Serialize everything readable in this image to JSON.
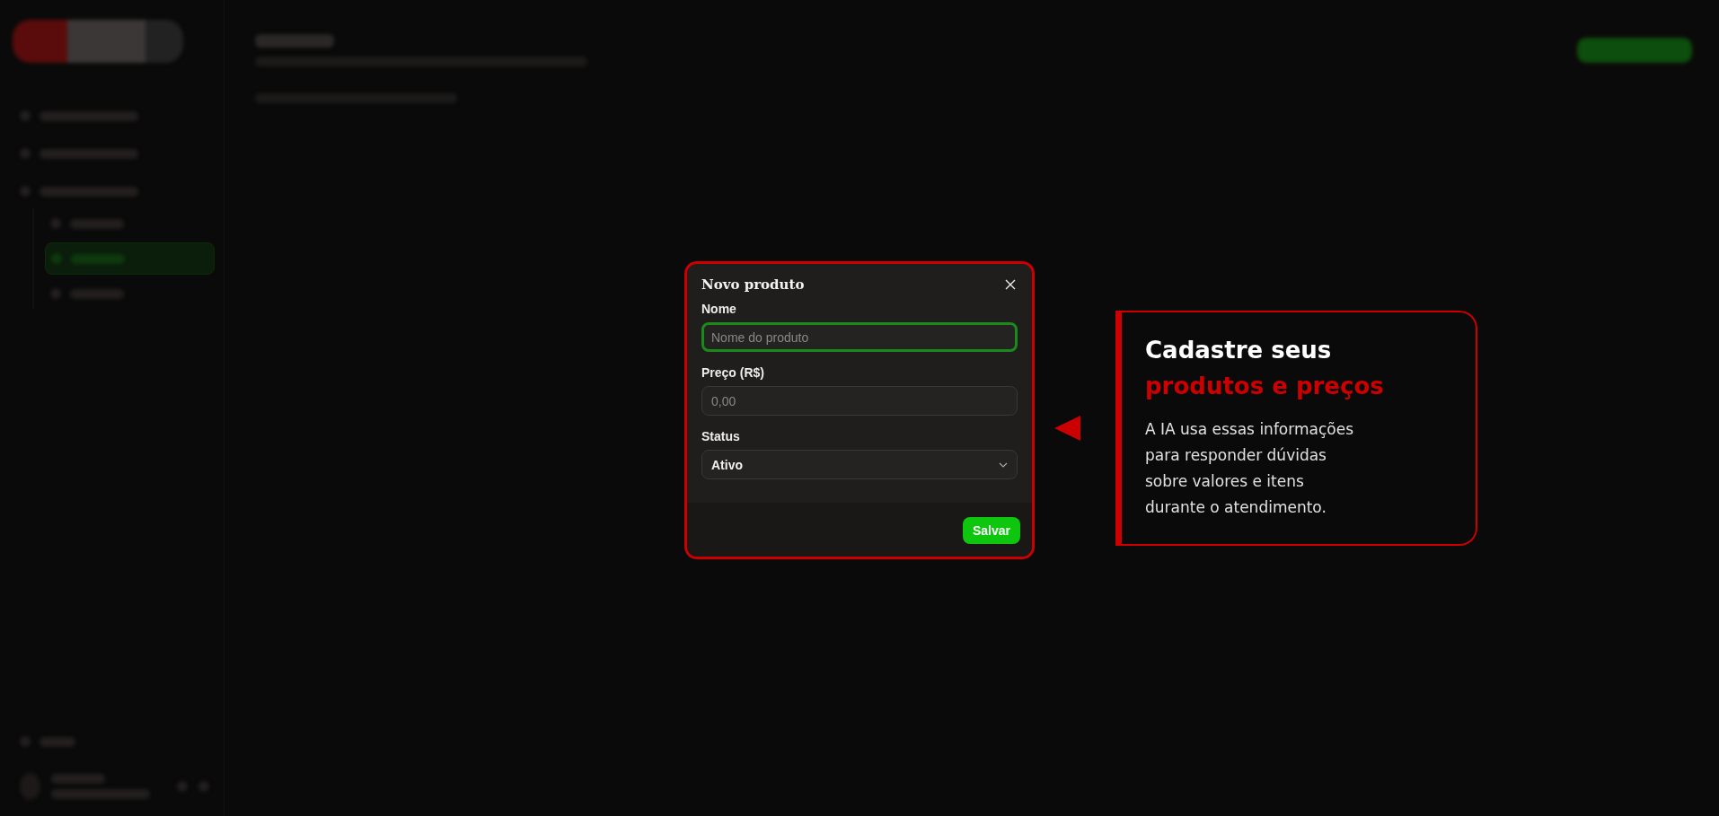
{
  "sidebar": {
    "items": [
      {
        "selected": false
      },
      {
        "selected": false
      },
      {
        "selected": false,
        "children": [
          {
            "selected": false
          },
          {
            "selected": true
          },
          {
            "selected": false
          }
        ]
      }
    ]
  },
  "dialog": {
    "title": "Novo produto",
    "fields": [
      {
        "kind": "text",
        "label": "Nome",
        "placeholder": "Nome do produto",
        "focused": true
      },
      {
        "kind": "text",
        "label": "Preço (R$)",
        "placeholder": "0,00",
        "focused": false
      },
      {
        "kind": "select",
        "label": "Status",
        "value": "Ativo",
        "focused": false
      }
    ],
    "save_button": "Salvar"
  },
  "callout": {
    "title": "Cadastre seus",
    "title_highlight": "produtos e preços",
    "body_lines": [
      "A IA usa essas informações",
      "para responder dúvidas",
      "sobre valores e itens",
      "durante o atendimento."
    ]
  }
}
